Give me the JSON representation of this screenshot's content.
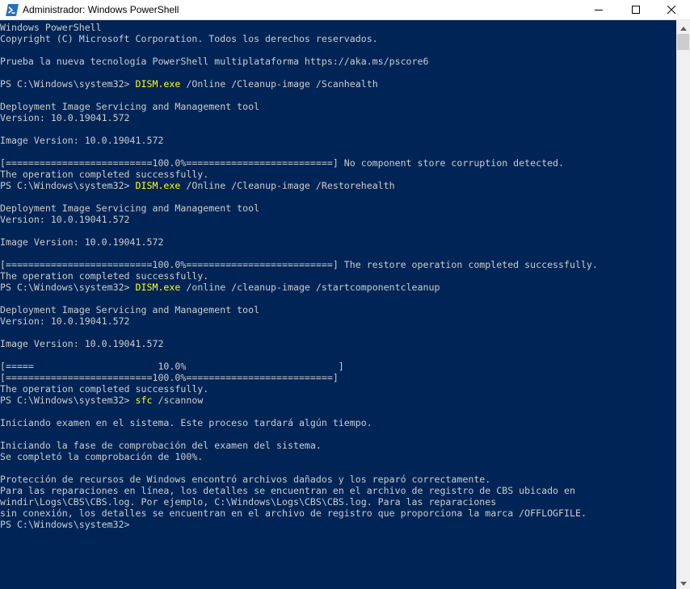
{
  "window": {
    "title": "Administrador: Windows PowerShell",
    "icons": {
      "app": "powershell-icon",
      "minimize": "minimize-icon",
      "maximize": "maximize-icon",
      "close": "close-icon"
    }
  },
  "colors": {
    "console_bg": "#012456",
    "text": "#cccccc",
    "command": "#ffff00",
    "titlebar": "#ffffff"
  },
  "console": {
    "lines": [
      {
        "segments": [
          {
            "text": "Windows PowerShell"
          }
        ]
      },
      {
        "segments": [
          {
            "text": "Copyright (C) Microsoft Corporation. Todos los derechos reservados."
          }
        ]
      },
      {
        "segments": []
      },
      {
        "segments": [
          {
            "text": "Prueba la nueva tecnología PowerShell multiplataforma https://aka.ms/pscore6"
          }
        ]
      },
      {
        "segments": []
      },
      {
        "segments": [
          {
            "text": "PS C:\\Windows\\system32> "
          },
          {
            "text": "DISM.exe",
            "color": "yellow"
          },
          {
            "text": " /Online /Cleanup-image /Scanhealth"
          }
        ]
      },
      {
        "segments": []
      },
      {
        "segments": [
          {
            "text": "Deployment Image Servicing and Management tool"
          }
        ]
      },
      {
        "segments": [
          {
            "text": "Version: 10.0.19041.572"
          }
        ]
      },
      {
        "segments": []
      },
      {
        "segments": [
          {
            "text": "Image Version: 10.0.19041.572"
          }
        ]
      },
      {
        "segments": []
      },
      {
        "segments": [
          {
            "text": "[==========================100.0%==========================] No component store corruption detected."
          }
        ]
      },
      {
        "segments": [
          {
            "text": "The operation completed successfully."
          }
        ]
      },
      {
        "segments": [
          {
            "text": "PS C:\\Windows\\system32> "
          },
          {
            "text": "DISM.exe",
            "color": "yellow"
          },
          {
            "text": " /Online /Cleanup-image /Restorehealth"
          }
        ]
      },
      {
        "segments": []
      },
      {
        "segments": [
          {
            "text": "Deployment Image Servicing and Management tool"
          }
        ]
      },
      {
        "segments": [
          {
            "text": "Version: 10.0.19041.572"
          }
        ]
      },
      {
        "segments": []
      },
      {
        "segments": [
          {
            "text": "Image Version: 10.0.19041.572"
          }
        ]
      },
      {
        "segments": []
      },
      {
        "segments": [
          {
            "text": "[==========================100.0%==========================] The restore operation completed successfully."
          }
        ]
      },
      {
        "segments": [
          {
            "text": "The operation completed successfully."
          }
        ]
      },
      {
        "segments": [
          {
            "text": "PS C:\\Windows\\system32> "
          },
          {
            "text": "DISM.exe",
            "color": "yellow"
          },
          {
            "text": " /online /cleanup-image /startcomponentcleanup"
          }
        ]
      },
      {
        "segments": []
      },
      {
        "segments": [
          {
            "text": "Deployment Image Servicing and Management tool"
          }
        ]
      },
      {
        "segments": [
          {
            "text": "Version: 10.0.19041.572"
          }
        ]
      },
      {
        "segments": []
      },
      {
        "segments": [
          {
            "text": "Image Version: 10.0.19041.572"
          }
        ]
      },
      {
        "segments": []
      },
      {
        "segments": [
          {
            "text": "[=====                      10.0%                           ]"
          }
        ]
      },
      {
        "segments": [
          {
            "text": "[==========================100.0%==========================]"
          }
        ]
      },
      {
        "segments": [
          {
            "text": "The operation completed successfully."
          }
        ]
      },
      {
        "segments": [
          {
            "text": "PS C:\\Windows\\system32> "
          },
          {
            "text": "sfc",
            "color": "yellow"
          },
          {
            "text": " /scannow"
          }
        ]
      },
      {
        "segments": []
      },
      {
        "segments": [
          {
            "text": "Iniciando examen en el sistema. Este proceso tardará algún tiempo."
          }
        ]
      },
      {
        "segments": []
      },
      {
        "segments": [
          {
            "text": "Iniciando la fase de comprobación del examen del sistema."
          }
        ]
      },
      {
        "segments": [
          {
            "text": "Se completó la comprobación de 100%."
          }
        ]
      },
      {
        "segments": []
      },
      {
        "segments": [
          {
            "text": "Protección de recursos de Windows encontró archivos dañados y los reparó correctamente."
          }
        ]
      },
      {
        "segments": [
          {
            "text": "Para las reparaciones en línea, los detalles se encuentran en el archivo de registro de CBS ubicado en"
          }
        ]
      },
      {
        "segments": [
          {
            "text": "windir\\Logs\\CBS\\CBS.log. Por ejemplo, C:\\Windows\\Logs\\CBS\\CBS.log. Para las reparaciones"
          }
        ]
      },
      {
        "segments": [
          {
            "text": "sin conexión, los detalles se encuentran en el archivo de registro que proporciona la marca /OFFLOGFILE."
          }
        ]
      },
      {
        "segments": [
          {
            "text": "PS C:\\Windows\\system32> "
          }
        ]
      }
    ]
  }
}
